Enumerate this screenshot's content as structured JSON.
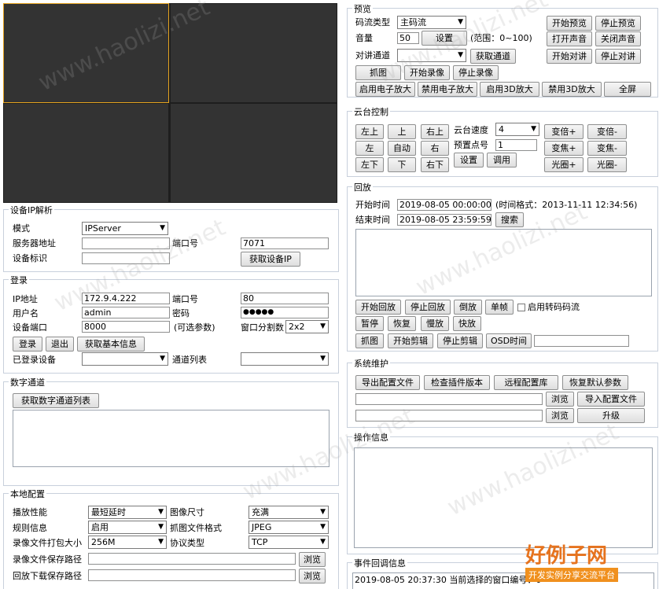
{
  "video": {
    "layout": "2x2"
  },
  "ip_parse": {
    "title": "设备IP解析",
    "mode_label": "模式",
    "mode_value": "IPServer",
    "server_label": "服务器地址",
    "server_value": "",
    "port_label": "端口号",
    "port_value": "7071",
    "device_id_label": "设备标识",
    "device_id_value": "",
    "get_ip_button": "获取设备IP"
  },
  "login": {
    "title": "登录",
    "ip_label": "IP地址",
    "ip_value": "172.9.4.222",
    "port_label": "端口号",
    "port_value": "80",
    "user_label": "用户名",
    "user_value": "admin",
    "password_label": "密码",
    "password_value": "●●●●●",
    "device_port_label": "设备端口",
    "device_port_value": "8000",
    "optional_note": "(可选参数)",
    "split_label": "窗口分割数",
    "split_value": "2x2",
    "login_button": "登录",
    "logout_button": "退出",
    "basic_info_button": "获取基本信息",
    "logged_devices_label": "已登录设备",
    "logged_devices_value": "",
    "channel_list_label": "通道列表",
    "channel_list_value": ""
  },
  "digital_channel": {
    "title": "数字通道",
    "get_list_button": "获取数字通道列表"
  },
  "local_config": {
    "title": "本地配置",
    "perf_label": "播放性能",
    "perf_value": "最短延时",
    "image_size_label": "图像尺寸",
    "image_size_value": "充满",
    "rule_label": "规则信息",
    "rule_value": "启用",
    "capture_format_label": "抓图文件格式",
    "capture_format_value": "JPEG",
    "pack_size_label": "录像文件打包大小",
    "pack_size_value": "256M",
    "protocol_label": "协议类型",
    "protocol_value": "TCP",
    "record_path_label": "录像文件保存路径",
    "download_path_label": "回放下载保存路径",
    "browse": "浏览"
  },
  "preview": {
    "title": "预览",
    "stream_label": "码流类型",
    "stream_value": "主码流",
    "volume_label": "音量",
    "volume_value": "50",
    "set_button": "设置",
    "volume_range": "(范围：0~100)",
    "talk_label": "对讲通道",
    "talk_value": "",
    "get_channel_button": "获取通道",
    "start_preview": "开始预览",
    "stop_preview": "停止预览",
    "open_sound": "打开声音",
    "close_sound": "关闭声音",
    "start_talk": "开始对讲",
    "stop_talk": "停止对讲",
    "capture": "抓图",
    "start_record": "开始录像",
    "stop_record": "停止录像",
    "enable_ezoom": "启用电子放大",
    "disable_ezoom": "禁用电子放大",
    "enable_3d": "启用3D放大",
    "disable_3d": "禁用3D放大",
    "fullscreen": "全屏"
  },
  "ptz": {
    "title": "云台控制",
    "up_left": "左上",
    "up": "上",
    "up_right": "右上",
    "left": "左",
    "auto": "自动",
    "right": "右",
    "down_left": "左下",
    "down": "下",
    "down_right": "右下",
    "speed_label": "云台速度",
    "speed_value": "4",
    "preset_label": "预置点号",
    "preset_value": "1",
    "set_button": "设置",
    "call_button": "调用",
    "zoom_in": "变倍+",
    "zoom_out": "变倍-",
    "focus_in": "变焦+",
    "focus_out": "变焦-",
    "iris_in": "光圈+",
    "iris_out": "光圈-"
  },
  "playback": {
    "title": "回放",
    "start_label": "开始时间",
    "start_value": "2019-08-05 00:00:00",
    "time_format": "(时间格式：2013-11-11 12:34:56)",
    "end_label": "结束时间",
    "end_value": "2019-08-05 23:59:59",
    "search_button": "搜索",
    "start_playback": "开始回放",
    "stop_playback": "停止回放",
    "reverse": "倒放",
    "single_frame": "单帧",
    "transcode_label": "启用转码码流",
    "pause": "暂停",
    "resume": "恢复",
    "slow": "慢放",
    "fast": "快放",
    "capture": "抓图",
    "start_clip": "开始剪辑",
    "stop_clip": "停止剪辑",
    "osd_time": "OSD时间",
    "osd_value": ""
  },
  "maintenance": {
    "title": "系统维护",
    "export_config": "导出配置文件",
    "check_plugin": "检查插件版本",
    "remote_config": "远程配置库",
    "restore_default": "恢复默认参数",
    "browse": "浏览",
    "import_config": "导入配置文件",
    "upgrade": "升级"
  },
  "op_info": {
    "title": "操作信息"
  },
  "event_info": {
    "title": "事件回调信息",
    "message": "2019-08-05 20:37:30 当前选择的窗口编号：0"
  },
  "watermark": {
    "text": "www.haolizi.net"
  },
  "brand": {
    "name": "好例子网",
    "slogan": "开发实例分享交流平台"
  }
}
